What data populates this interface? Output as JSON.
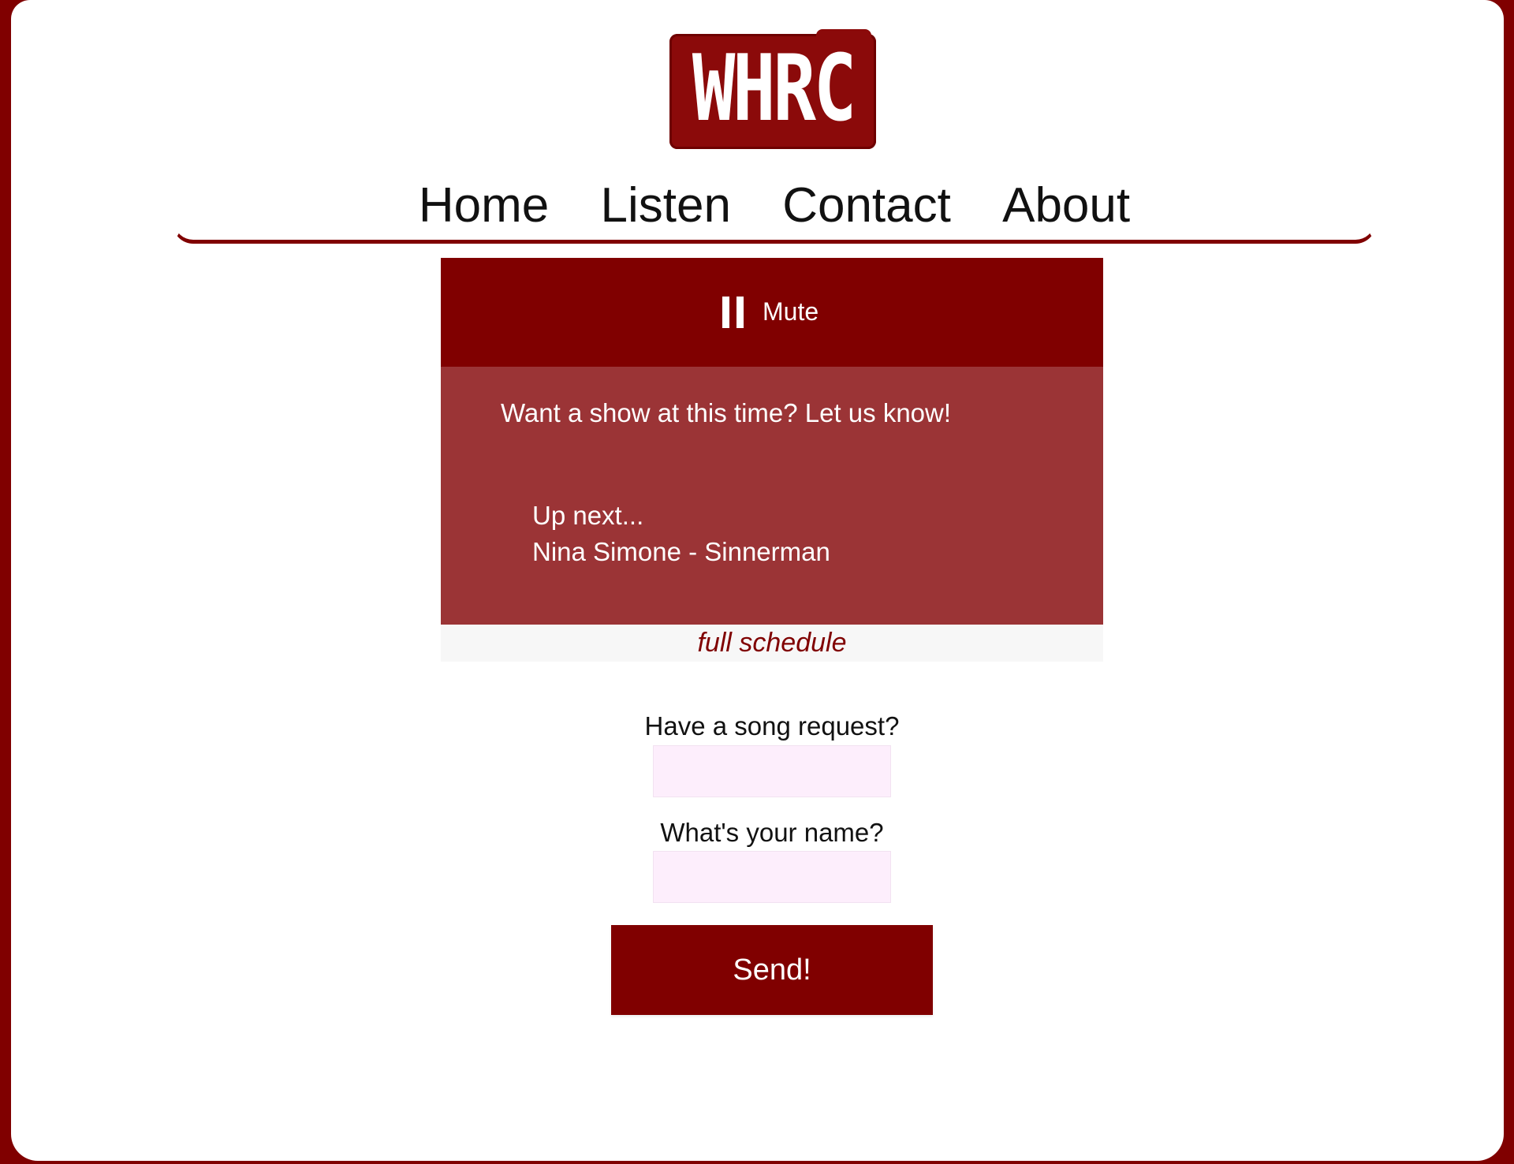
{
  "logo": {
    "text": "WHRC"
  },
  "nav": {
    "items": [
      {
        "label": "Home"
      },
      {
        "label": "Listen"
      },
      {
        "label": "Contact"
      },
      {
        "label": "About"
      }
    ]
  },
  "player": {
    "control_label": "Mute",
    "icon": "pause-icon",
    "cta": "Want a show at this time? Let us know!",
    "up_next_label": "Up next...",
    "up_next_track": "Nina Simone - Sinnerman",
    "schedule_link": "full schedule"
  },
  "form": {
    "song_label": "Have a song request?",
    "song_value": "",
    "name_label": "What's your name?",
    "name_value": "",
    "submit_label": "Send!"
  },
  "colors": {
    "brand": "#800000",
    "panel": "#9b3436",
    "input_bg": "#fdeefc"
  }
}
